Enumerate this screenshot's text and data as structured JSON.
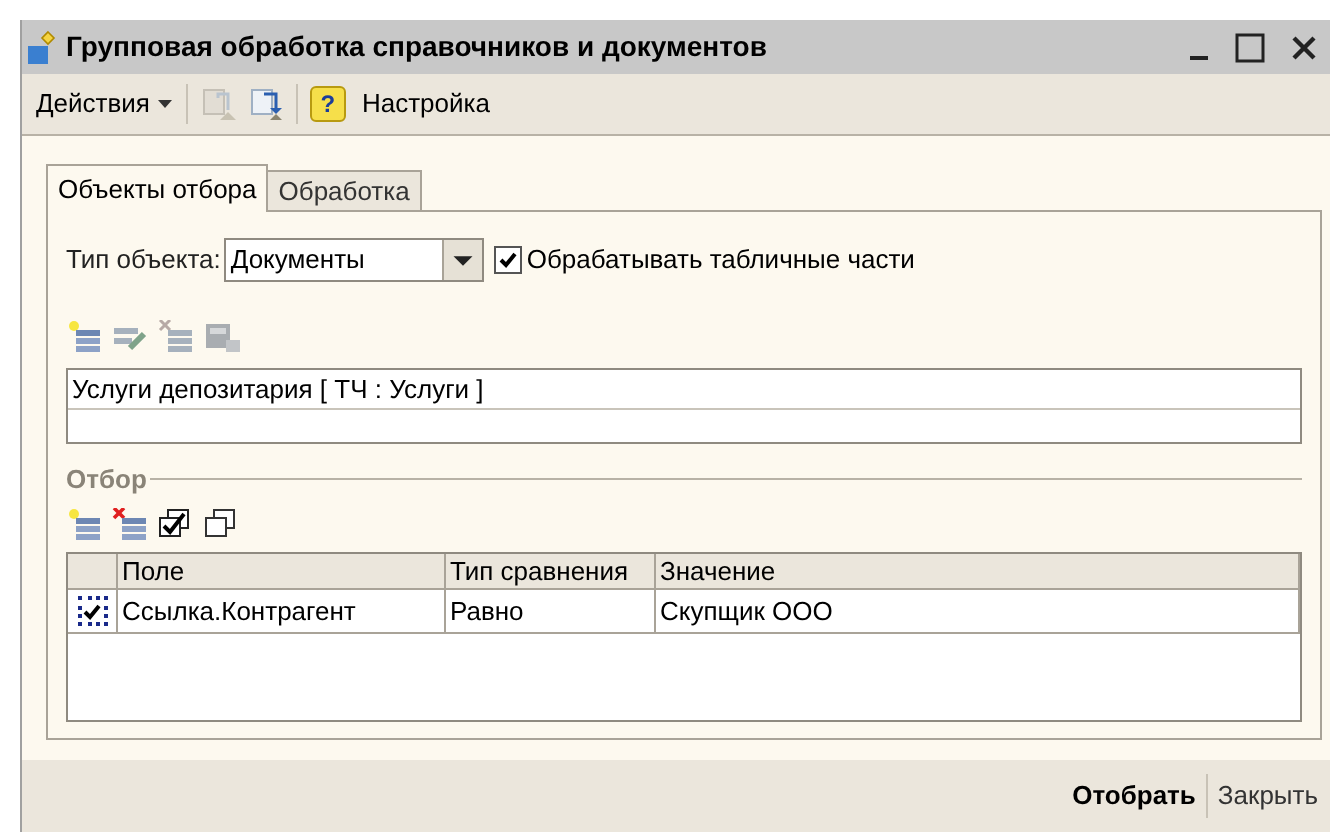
{
  "window": {
    "title": "Групповая обработка справочников и документов"
  },
  "toolbar": {
    "actions_menu": "Действия",
    "help_button": "?",
    "settings": "Настройка"
  },
  "tabs": [
    {
      "label": "Объекты отбора",
      "selected": true
    },
    {
      "label": "Обработка",
      "selected": false
    }
  ],
  "object_type": {
    "label": "Тип объекта:",
    "value": "Документы"
  },
  "process_tables": {
    "label": "Обрабатывать табличные части",
    "checked": true
  },
  "objects_list": {
    "rows": [
      "Услуги депозитария [ ТЧ : Услуги ]"
    ]
  },
  "filter": {
    "title": "Отбор",
    "columns": [
      "Поле",
      "Тип сравнения",
      "Значение"
    ],
    "rows": [
      {
        "checked": true,
        "field": "Ссылка.Контрагент",
        "comparison": "Равно",
        "value": "Скупщик ООО"
      }
    ]
  },
  "buttons": [
    {
      "label": "Отобрать",
      "default": true
    },
    {
      "label": "Закрыть",
      "default": false
    }
  ]
}
